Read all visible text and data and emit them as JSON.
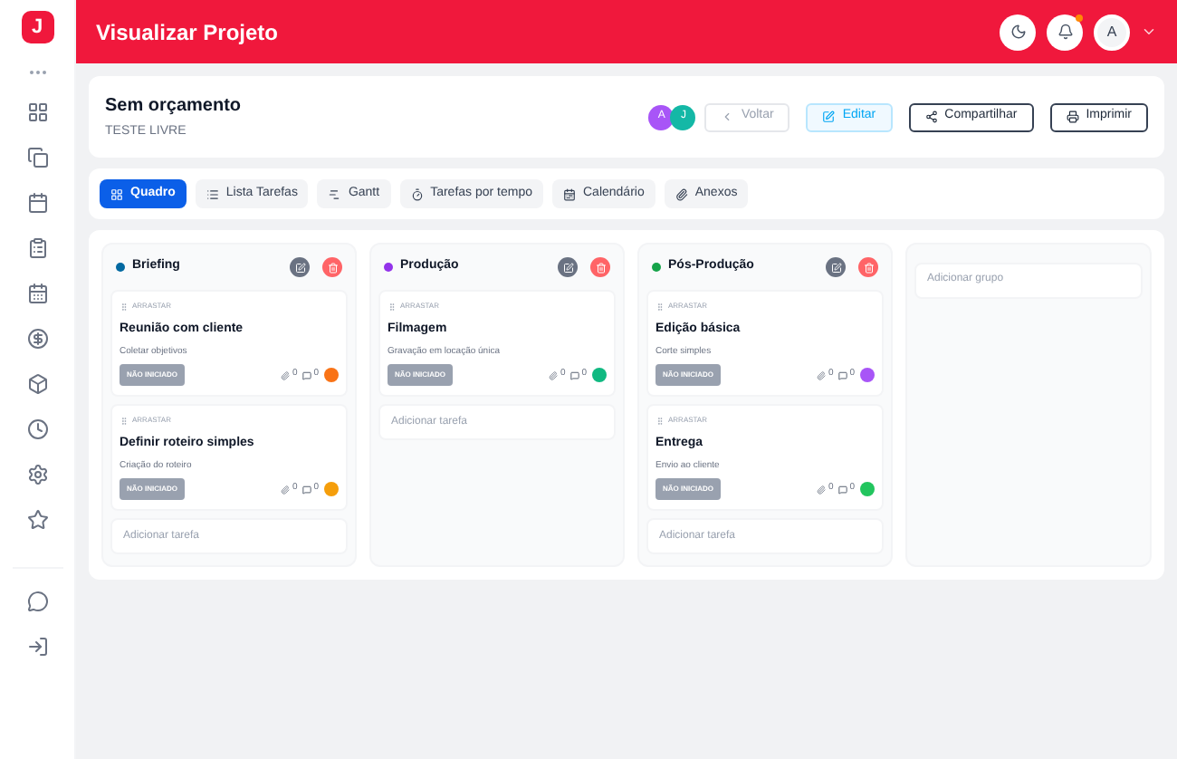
{
  "logo": "J",
  "header": {
    "title": "Visualizar Projeto",
    "avatar": "A"
  },
  "project": {
    "title": "Sem orçamento",
    "subtitle": "TESTE LIVRE",
    "members": [
      {
        "initial": "A",
        "color": "#a855f7"
      },
      {
        "initial": "J",
        "color": "#14b8a6"
      }
    ],
    "buttons": [
      {
        "label": "Voltar",
        "kind": "back"
      },
      {
        "label": "Editar",
        "kind": "edit"
      },
      {
        "label": "Compartilhar",
        "kind": "share"
      },
      {
        "label": "Imprimir",
        "kind": "print"
      }
    ]
  },
  "tabs": [
    {
      "label": "Quadro",
      "selected": true
    },
    {
      "label": "Lista Tarefas",
      "selected": false
    },
    {
      "label": "Gantt",
      "selected": false
    },
    {
      "label": "Tarefas por tempo",
      "selected": false
    },
    {
      "label": "Calendário",
      "selected": false
    },
    {
      "label": "Anexos",
      "selected": false
    }
  ],
  "columns": [
    {
      "name": "Briefing",
      "color": "#0369a1",
      "add_label": "Adicionar tarefa",
      "tasks": [
        {
          "drag": "ARRASTAR",
          "title": "Reunião com cliente",
          "description": "Coletar objetivos",
          "status": "NÃO INICIADO",
          "attachments": "0",
          "comments": "0",
          "color": "#f97316"
        },
        {
          "drag": "ARRASTAR",
          "title": "Definir roteiro simples",
          "description": "Criação do roteiro",
          "status": "NÃO INICIADO",
          "attachments": "0",
          "comments": "0",
          "color": "#f59e0b"
        }
      ]
    },
    {
      "name": "Produção",
      "color": "#9333ea",
      "add_label": "Adicionar tarefa",
      "tasks": [
        {
          "drag": "ARRASTAR",
          "title": "Filmagem",
          "description": "Gravação em locação única",
          "status": "NÃO INICIADO",
          "attachments": "0",
          "comments": "0",
          "color": "#10b981"
        }
      ]
    },
    {
      "name": "Pós-Produção",
      "color": "#16a34a",
      "add_label": "Adicionar tarefa",
      "tasks": [
        {
          "drag": "ARRASTAR",
          "title": "Edição básica",
          "description": "Corte simples",
          "status": "NÃO INICIADO",
          "attachments": "0",
          "comments": "0",
          "color": "#a855f7"
        },
        {
          "drag": "ARRASTAR",
          "title": "Entrega",
          "description": "Envio ao cliente",
          "status": "NÃO INICIADO",
          "attachments": "0",
          "comments": "0",
          "color": "#22c55e"
        }
      ]
    }
  ],
  "add_group": "Adicionar grupo"
}
